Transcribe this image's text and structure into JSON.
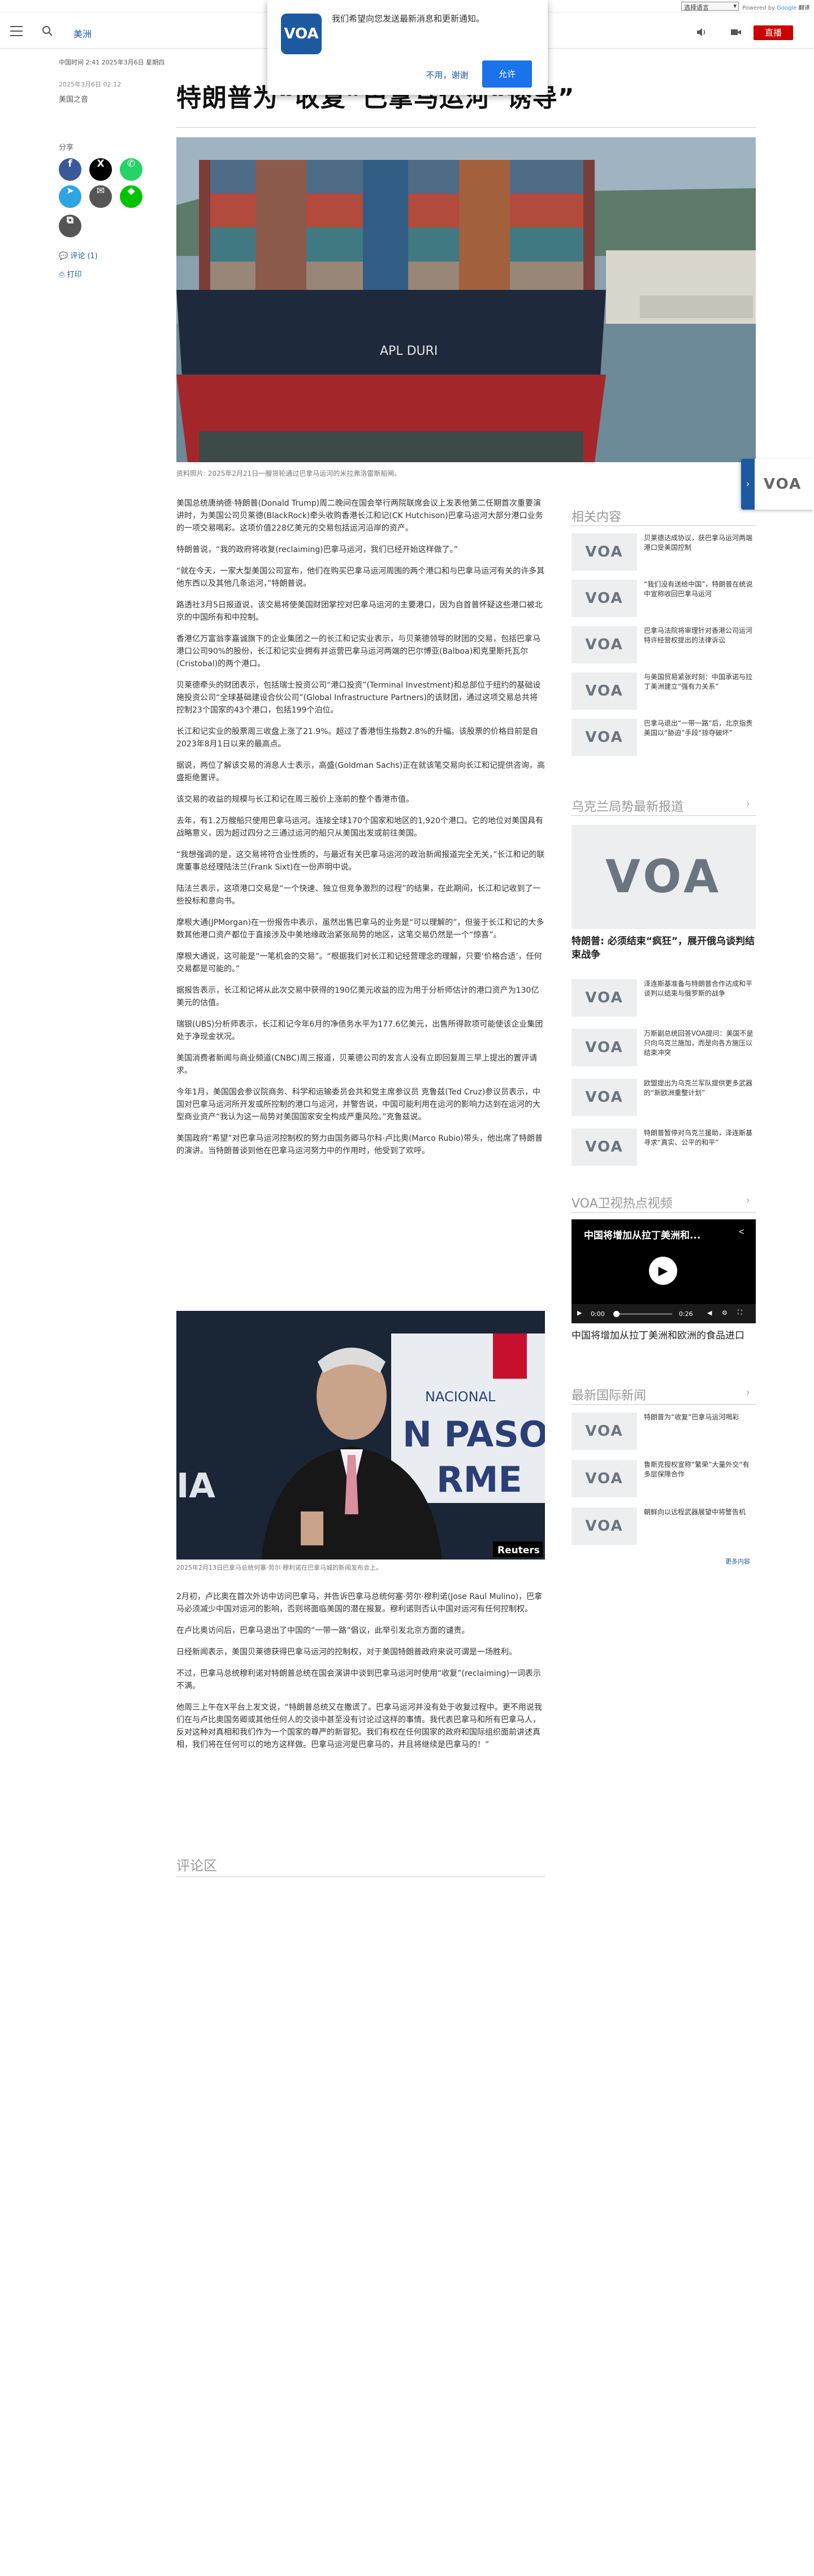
{
  "translate_bar": {
    "select_label": "选择语言",
    "powered_by": "Powered by",
    "translate_brand": "Google",
    "translate_word": "翻译"
  },
  "header": {
    "region": "美洲",
    "live_label": "直播"
  },
  "popup": {
    "logo_text": "VOA",
    "message": "我们希望向您发送最新消息和更新通知。",
    "decline": "不用，谢谢",
    "accept": "允许"
  },
  "article": {
    "dateline": "中国时间 2:41 2025年3月6日 星期四",
    "published": "2025年3月6日 02:12",
    "category": "美国之音",
    "title": "特朗普为“收复”巴拿马运河“诱导”",
    "share_label": "分享",
    "comments_link": "评论 (1)",
    "print_link": "打印",
    "hero_caption": "资料照片: 2025年2月21日一艘货轮通过巴拿马运河的米拉弗洛雷斯船闸。",
    "paragraphs": [
      "美国总统唐纳德·特朗普(Donald Trump)周二晚间在国会举行两院联席会议上发表他第二任期首次重要演讲时，为美国公司贝莱德(BlackRock)牵头收购香港长江和记(CK Hutchison)巴拿马运河大部分港口业务的一项交易喝彩。这项价值228亿美元的交易包括运河沿岸的资产。",
      "特朗普说，“我的政府将收复(reclaiming)巴拿马运河，我们已经开始这样做了。”",
      "“就在今天，一家大型美国公司宣布，他们在购买巴拿马运河周围的两个港口和与巴拿马运河有关的许多其他东西以及其他几条运河，”特朗普说。",
      "路透社3月5日报道说，该交易将使美国财团掌控对巴拿马运河的主要港口，因为自首普怀疑这些港口被北京的中国所有和中控制。",
      "香港亿万富翁李嘉诚旗下的企业集团之一的长江和记实业表示，与贝莱德领导的财团的交易，包括巴拿马港口公司90%的股份，长江和记实业拥有并运营巴拿马运河两端的巴尔博亚(Balboa)和克里斯托瓦尔(Cristobal)的两个港口。",
      "贝莱德牵头的财团表示，包括瑞士投资公司“港口投资”(Terminal Investment)和总部位于纽约的基础设施投资公司“全球基础建设合伙公司”(Global Infrastructure Partners)的该财团，通过这项交易总共将控制23个国家的43个港口，包括199个泊位。",
      "长江和记实业的股票周三收盘上涨了21.9%。超过了香港恒生指数2.8%的升幅。该股票的价格目前是自2023年8月1日以来的最高点。",
      "据说，两位了解该交易的消息人士表示，高盛(Goldman Sachs)正在就该笔交易向长江和记提供咨询，高盛拒绝置评。",
      "该交易的收益的规模与长江和记在周三股价上涨前的整个香港市值。",
      "去年，有1.2万艘船只使用巴拿马运河。连接全球170个国家和地区的1,920个港口。它的地位对美国具有战略意义，因为超过四分之三通过运河的船只从美国出发或前往美国。",
      "“我想强调的是，这交易将符合业性质的，与最近有关巴拿马运河的政治新闻报道完全无关，”长江和记的联席董事总经理陆法兰(Frank Sixt)在一份声明中说。",
      "陆法兰表示，这项港口交易是“一个快速、独立但竞争激烈的过程”的结果，在此期间，长江和记收到了一些投标和意向书。",
      "摩根大通(JPMorgan)在一份报告中表示，虽然出售巴拿马的业务是“可以理解的”，但鉴于长江和记的大多数其他港口资产都位于直接涉及中美地缘政治紧张局势的地区，这笔交易仍然是一个“惊喜”。",
      "摩根大通说，这可能是“一笔机会的交易”。“根据我们对长江和记经营理念的理解，只要‘价格合适’，任何交易都是可能的。”",
      "据报告表示，长江和记将从此次交易中获得的190亿美元收益的应为用于分析师估计的港口资产为130亿美元的估值。",
      "瑞银(UBS)分析师表示，长江和记今年6月的净债务水平为177.6亿美元，出售所得款项可能使该企业集团处于净现金状况。",
      "美国消费者新闻与商业频道(CNBC)周三报道，贝莱德公司的发言人没有立即回复周三早上提出的置评请求。",
      "今年1月，美国国会参议院商务、科学和运输委员会共和党主席参议员 克鲁兹(Ted Cruz)参议员表示，中国对巴拿马运河所开发或所控制的港口与运河，并警告说，中国可能利用在运河的影响力达到在运河的大型商业资产“我认为这一局势对美国国家安全构成严重风险。”克鲁兹说。",
      "美国政府“希望”对巴拿马运河控制权的努力由国务卿马尔科·卢比奥(Marco Rubio)带头，他出席了特朗普的演讲。当特朗普谈到他在巴拿马运河努力中的作用时，他受到了欢呼。"
    ],
    "fig2_caption": "2025年2月13日巴拿马总统何塞·劳尔·穆利诺在巴拿马城的新闻发布会上。",
    "fig2_badge": "Reuters",
    "fig2_sign_a": "NACIONAL",
    "fig2_sign_b": "N PASO",
    "fig2_sign_c": "RME",
    "fig2_sign_d": "IA",
    "paragraphs2": [
      "2月初，卢比奥在首次外访中访问巴拿马，并告诉巴拿马总统何塞·劳尔·穆利诺(Jose Raul Mulino)，巴拿马必须减少中国对运河的影响，否则将面临美国的潜在报复。穆利诺则否认中国对运河有任何控制权。",
      "在卢比奥访问后，巴拿马退出了中国的“一带一路”倡议，此举引发北京方面的谴责。",
      "日经新闻表示，美国贝莱德获得巴拿马运河的控制权，对于美国特朗普政府来说可谓是一场胜利。",
      "不过，巴拿马总统穆利诺对特朗普总统在国会演讲中谈到巴拿马运河时使用“收复”(reclaiming)一词表示不满。",
      "他周三上午在X平台上发文说，“特朗普总统又在撒谎了。巴拿马运河并没有处于收复过程中。更不用说我们在与卢比奥国务卿或其他任何人的交谈中甚至没有讨论过这样的事情。我代表巴拿马和所有巴拿马人，反对这种对真相和我们作为一个国家的尊严的新冒犯。我们有权在任何国家的政府和国际组织面前讲述真相，我们将在任何可以的地方这样做。巴拿马运河是巴拿马的，并且将继续是巴拿马的！”"
    ],
    "comments_heading": "评论区"
  },
  "float_tab": {
    "logo_text": "VOA"
  },
  "sidebar": {
    "related_heading": "相关内容",
    "related": [
      {
        "thumb": "VOA",
        "text": "贝莱德达成协议，获巴拿马运河两端港口受美国控制"
      },
      {
        "thumb": "VOA",
        "text": "“我们没有送给中国”，特朗普在统说中宣称收回巴拿马运河"
      },
      {
        "thumb": "VOA",
        "text": "巴拿马法院将审理针对香港公司运河特许经营权提出的法律诉讼"
      },
      {
        "thumb": "VOA",
        "text": "与美国贸易紧张时刻：中国承诺与拉丁美洲建立“强有力关系”"
      },
      {
        "thumb": "VOA",
        "text": "巴拿马退出“一带一路”后，北京指责美国以“胁迫”手段“掠夺破坏”"
      }
    ],
    "ukraine_heading": "乌克兰局势最新报道",
    "ukraine_big_thumb": "VOA",
    "ukraine_big_title": "特朗普: 必须结束“疯狂”，展开俄乌谈判结束战争",
    "ukraine": [
      {
        "thumb": "VOA",
        "text": "泽连斯基准备与特朗普合作达成和平谈判以结束与俄罗斯的战争"
      },
      {
        "thumb": "VOA",
        "text": "万斯副总统回答VOA提问：美国不是只向乌克兰施加，而是向各方施压以结束冲突"
      },
      {
        "thumb": "VOA",
        "text": "欧盟提出为乌克兰军队提供更多武器的“新欧洲重整计划”"
      },
      {
        "thumb": "VOA",
        "text": "特朗普暂停对乌克兰援助，泽连斯基寻求“真实、公平的和平”"
      }
    ],
    "video_heading": "VOA卫视热点视频",
    "video_overlay_title": "中国将增加从拉丁美洲和...",
    "video_time_current": "0:00",
    "video_time_total": "0:26",
    "video_title": "中国将增加从拉丁美洲和欧洲的食品进口",
    "intl_heading": "最新国际新闻",
    "intl": [
      {
        "thumb": "VOA",
        "text": "特朗普为“收复”巴拿马运河喝彩"
      },
      {
        "thumb": "VOA",
        "text": "鲁斯克授权宣称“繁荣”大量外交“有多层保障合作"
      },
      {
        "thumb": "VOA",
        "text": "朝鲜向以远程武器展望中将警告机"
      }
    ],
    "more_link": "更多内容"
  },
  "colors": {
    "accent": "#1d59a0",
    "live": "#cc0000",
    "facebook": "#3b5998",
    "x": "#000000",
    "whatsapp": "#25d366",
    "telegram": "#2ca5e0",
    "email": "#555555",
    "line": "#00c300",
    "copy": "#555555"
  },
  "icons": [
    "hamburger-menu-icon",
    "search-icon",
    "speaker-icon",
    "video-icon",
    "facebook-icon",
    "x-icon",
    "whatsapp-icon",
    "telegram-icon",
    "email-icon",
    "line-icon",
    "copy-icon",
    "comment-icon",
    "print-icon",
    "play-icon",
    "share-icon",
    "chevron-right-icon"
  ]
}
